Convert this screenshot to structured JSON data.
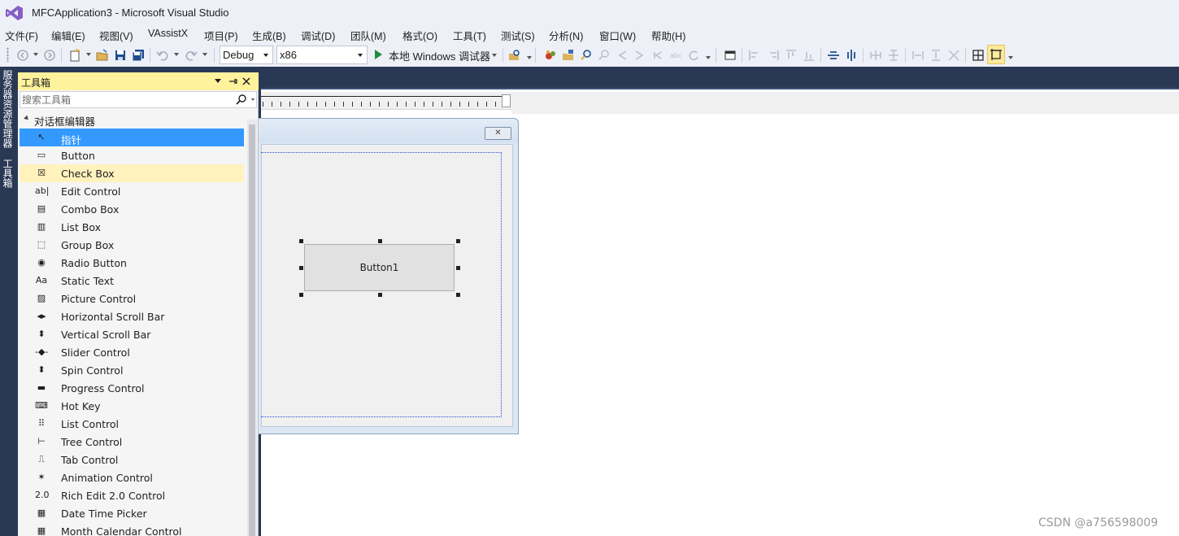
{
  "window": {
    "title": "MFCApplication3 - Microsoft Visual Studio"
  },
  "menu": [
    {
      "label": "文件(F)"
    },
    {
      "label": "编辑(E)"
    },
    {
      "label": "视图(V)"
    },
    {
      "label": "VAssistX"
    },
    {
      "label": "项目(P)"
    },
    {
      "label": "生成(B)"
    },
    {
      "label": "调试(D)"
    },
    {
      "label": "团队(M)"
    },
    {
      "label": "格式(O)"
    },
    {
      "label": "工具(T)"
    },
    {
      "label": "测试(S)"
    },
    {
      "label": "分析(N)"
    },
    {
      "label": "窗口(W)"
    },
    {
      "label": "帮助(H)"
    }
  ],
  "toolbar": {
    "configuration": "Debug",
    "platform": "x86",
    "run_label": "本地 Windows 调试器",
    "active_tool": "toggle-guides-icon"
  },
  "side_tabs": [
    {
      "label": "服务器资源管理器"
    },
    {
      "label": "工具箱"
    }
  ],
  "toolbox": {
    "title": "工具箱",
    "search_placeholder": "搜索工具箱",
    "group": "对话框编辑器",
    "items": [
      {
        "label": "指针",
        "icon": "pointer-icon",
        "glyph": "↖"
      },
      {
        "label": "Button",
        "icon": "button-icon",
        "glyph": "▭"
      },
      {
        "label": "Check Box",
        "icon": "checkbox-icon",
        "glyph": "☒"
      },
      {
        "label": "Edit Control",
        "icon": "edit-control-icon",
        "glyph": "ab|"
      },
      {
        "label": "Combo Box",
        "icon": "combo-box-icon",
        "glyph": "▤"
      },
      {
        "label": "List Box",
        "icon": "list-box-icon",
        "glyph": "▥"
      },
      {
        "label": "Group Box",
        "icon": "group-box-icon",
        "glyph": "⬚"
      },
      {
        "label": "Radio Button",
        "icon": "radio-button-icon",
        "glyph": "◉"
      },
      {
        "label": "Static Text",
        "icon": "static-text-icon",
        "glyph": "Aa"
      },
      {
        "label": "Picture Control",
        "icon": "picture-control-icon",
        "glyph": "▨"
      },
      {
        "label": "Horizontal Scroll Bar",
        "icon": "hscroll-icon",
        "glyph": "◂▸"
      },
      {
        "label": "Vertical Scroll Bar",
        "icon": "vscroll-icon",
        "glyph": "⬍"
      },
      {
        "label": "Slider Control",
        "icon": "slider-icon",
        "glyph": "-◆-"
      },
      {
        "label": "Spin Control",
        "icon": "spin-icon",
        "glyph": "⬍"
      },
      {
        "label": "Progress Control",
        "icon": "progress-icon",
        "glyph": "▬"
      },
      {
        "label": "Hot Key",
        "icon": "hotkey-icon",
        "glyph": "⌨"
      },
      {
        "label": "List Control",
        "icon": "list-control-icon",
        "glyph": "⠿"
      },
      {
        "label": "Tree Control",
        "icon": "tree-control-icon",
        "glyph": "⊢"
      },
      {
        "label": "Tab Control",
        "icon": "tab-control-icon",
        "glyph": "⎍"
      },
      {
        "label": "Animation Control",
        "icon": "animation-icon",
        "glyph": "✶"
      },
      {
        "label": "Rich Edit 2.0 Control",
        "icon": "rich-edit-icon",
        "glyph": "2.0"
      },
      {
        "label": "Date Time Picker",
        "icon": "date-time-icon",
        "glyph": "▦"
      },
      {
        "label": "Month Calendar Control",
        "icon": "calendar-icon",
        "glyph": "▦"
      }
    ]
  },
  "designer": {
    "button_label": "Button1",
    "dialog_close_glyph": "✕"
  },
  "watermark": "CSDN @a756598009"
}
